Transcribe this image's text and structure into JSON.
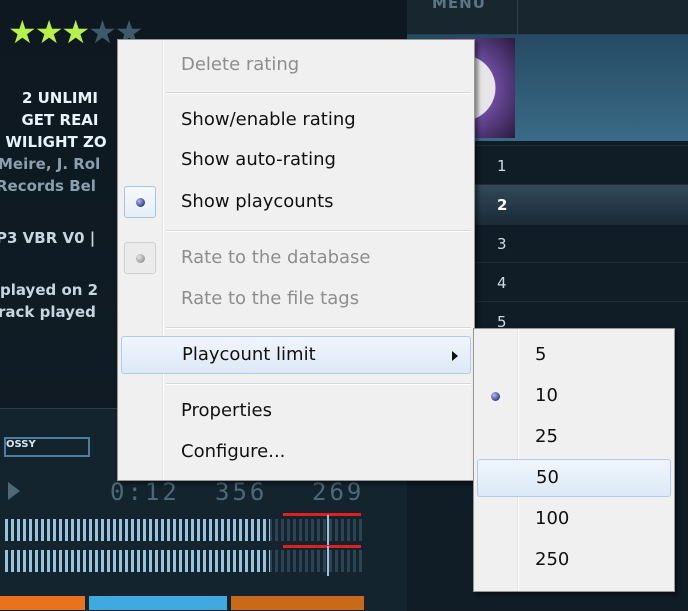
{
  "player": {
    "rating_stars": "★★★",
    "rating_stars_empty": "★★",
    "info_lines": [
      "2 UNLIMI",
      "GET REAI",
      "WILIGHT ZO"
    ],
    "info_sub": [
      "Meire, J. Rol",
      "Records Bel"
    ],
    "format": "P3 VBR V0 |",
    "played_lines": [
      "played on 2",
      "rack played"
    ],
    "menu_label": "MENU",
    "glossy_label": "OSSY",
    "lcd_values": [
      "0:12",
      "356",
      "269"
    ],
    "playlist_numbers": [
      "1",
      "2",
      "3",
      "4",
      "5"
    ]
  },
  "context_menu": {
    "items": [
      {
        "label": "Delete rating",
        "enabled": false
      },
      {
        "label": "Show/enable rating",
        "enabled": true
      },
      {
        "label": "Show auto-rating",
        "enabled": true
      },
      {
        "label": "Show playcounts",
        "enabled": true,
        "checked": true
      },
      {
        "label": "Rate to the database",
        "enabled": false,
        "checked": true
      },
      {
        "label": "Rate to the file tags",
        "enabled": false
      },
      {
        "label": "Playcount limit",
        "enabled": true,
        "submenu": true,
        "highlighted": true
      },
      {
        "label": "Properties",
        "enabled": true
      },
      {
        "label": "Configure...",
        "enabled": true
      }
    ]
  },
  "submenu": {
    "items": [
      {
        "label": "5"
      },
      {
        "label": "10",
        "checked": true
      },
      {
        "label": "25"
      },
      {
        "label": "50",
        "highlighted": true
      },
      {
        "label": "100"
      },
      {
        "label": "250"
      }
    ]
  },
  "colors": {
    "menu_bg": "#f0f0f0",
    "highlight_border": "#aecbeb",
    "star_on": "#b8f04a",
    "bullet": "#3b3e8e"
  }
}
